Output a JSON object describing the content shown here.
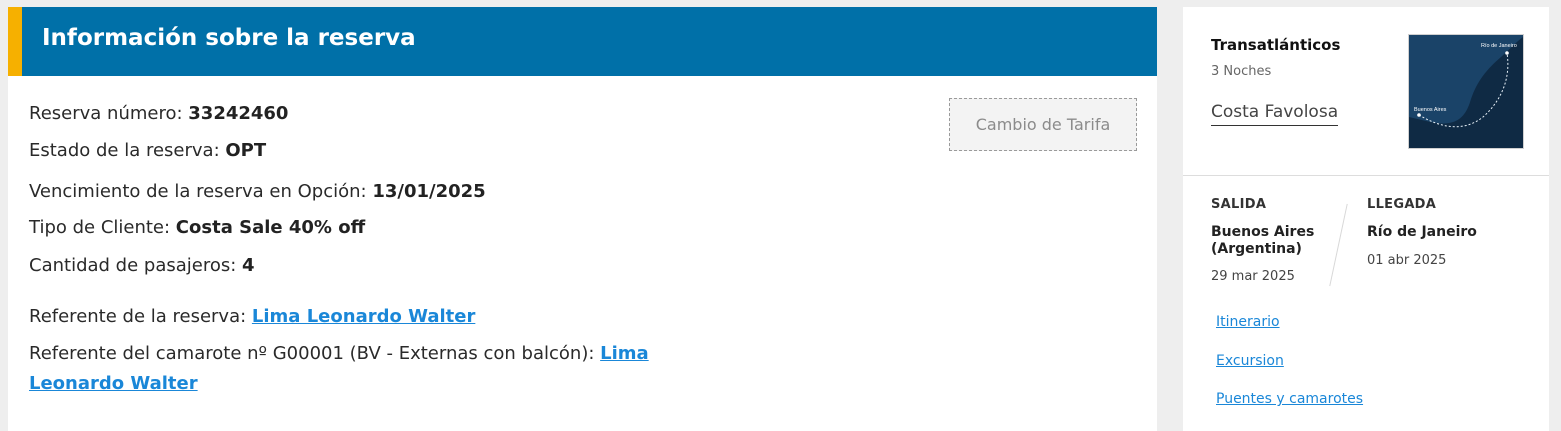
{
  "booking": {
    "header_title": "Información sobre la reserva",
    "reserva_numero_label": "Reserva número: ",
    "reserva_numero_value": "33242460",
    "estado_label": "Estado de la reserva: ",
    "estado_value": "OPT",
    "vencimiento_label": "Vencimiento de la reserva en Opción: ",
    "vencimiento_value": "13/01/2025",
    "tipo_cliente_label": "Tipo de Cliente: ",
    "tipo_cliente_value": "Costa Sale 40% off",
    "pasajeros_label": "Cantidad de pasajeros: ",
    "pasajeros_value": "4",
    "referente_reserva_label": "Referente de la reserva: ",
    "referente_reserva_name": "Lima Leonardo Walter",
    "referente_camarote_label": "Referente del camarote nº G00001 (BV - Externas con balcón): ",
    "referente_camarote_name_line1": "Lima",
    "referente_camarote_name_line2": "Leonardo Walter",
    "cambio_tarifa_button": "Cambio de Tarifa"
  },
  "cruise": {
    "type": "Transatlánticos",
    "nights": "3 Noches",
    "ship": "Costa Favolosa",
    "map": {
      "label_start": "Buenos Aires",
      "label_end": "Río de Janeiro",
      "sea_color": "#173a5c",
      "land_color": "#0f2a44"
    },
    "salida_label": "SALIDA",
    "salida_city": "Buenos Aires (Argentina)",
    "salida_city_line1": "Buenos Aires",
    "salida_city_line2": "(Argentina)",
    "salida_date": "29 mar 2025",
    "llegada_label": "LLEGADA",
    "llegada_city": "Río de Janeiro",
    "llegada_date": "01 abr 2025",
    "links": [
      "Itinerario",
      "Excursion",
      "Puentes y camarotes"
    ]
  },
  "colors": {
    "header_blue": "#0070a8",
    "header_accent": "#f6b000",
    "link_blue": "#1a87d8"
  }
}
